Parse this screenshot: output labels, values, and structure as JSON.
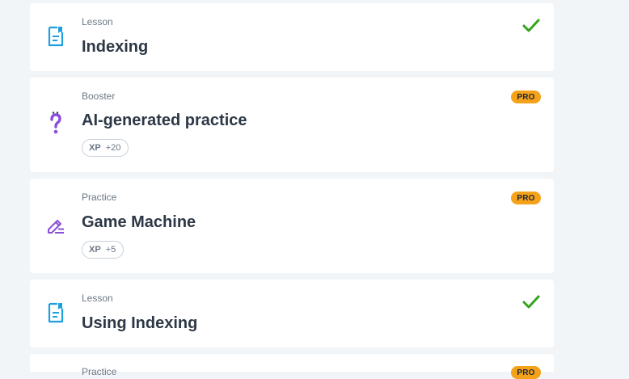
{
  "colors": {
    "page_background": "#f2f5f7",
    "card_background": "#ffffff",
    "lesson_icon": "#1e9fe0",
    "practice_icon": "#8a4fd8",
    "check": "#34a51a",
    "pro_badge": "#f5a21b",
    "title_text": "#2d3846",
    "muted_text": "#6b7785"
  },
  "items": [
    {
      "kind": "Lesson",
      "title": "Indexing",
      "icon": "lesson-document-icon",
      "status": "completed"
    },
    {
      "kind": "Booster",
      "title": "AI-generated practice",
      "icon": "question-mark-icon",
      "badge": "PRO",
      "xp_label": "XP",
      "xp_value": "+20"
    },
    {
      "kind": "Practice",
      "title": "Game Machine",
      "icon": "pencil-edit-icon",
      "badge": "PRO",
      "xp_label": "XP",
      "xp_value": "+5"
    },
    {
      "kind": "Lesson",
      "title": "Using Indexing",
      "icon": "lesson-document-icon",
      "status": "completed"
    },
    {
      "kind": "Practice",
      "title": "",
      "badge": "PRO"
    }
  ]
}
